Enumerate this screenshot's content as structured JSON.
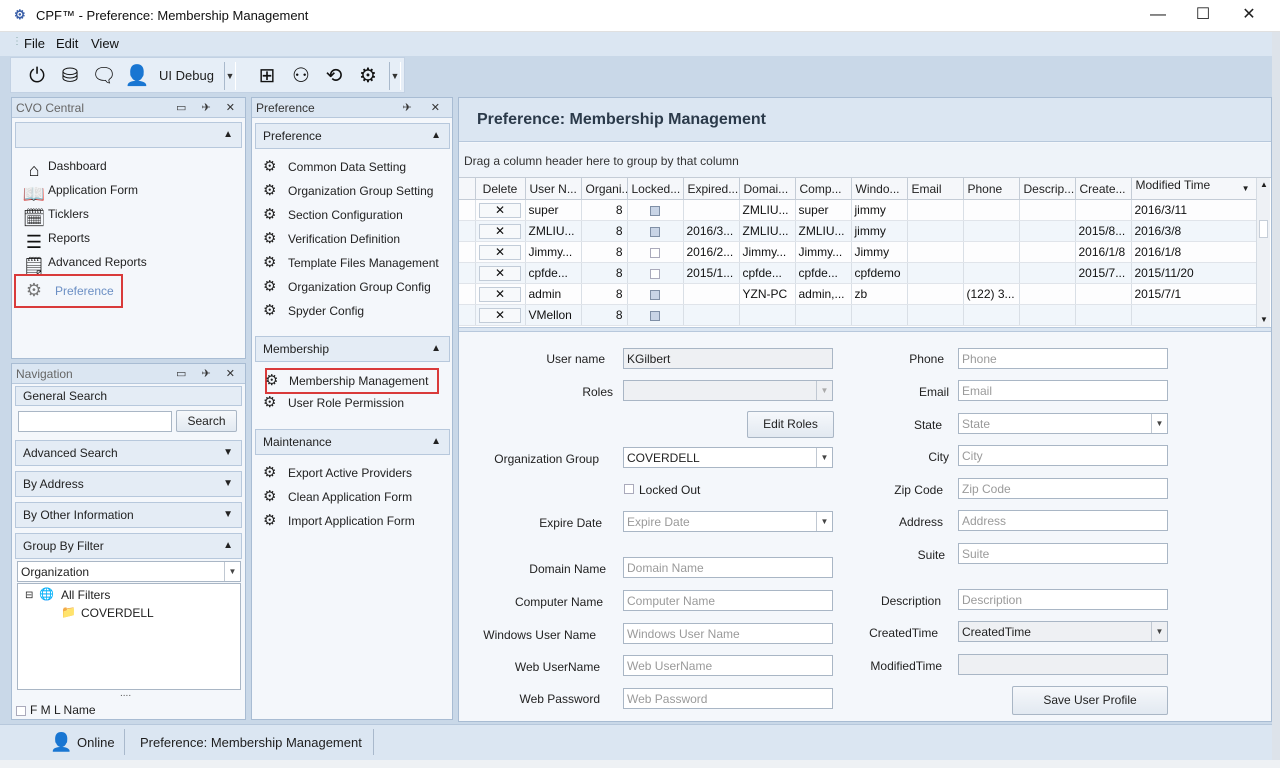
{
  "window": {
    "app_title": "CPF™  -  Preference: Membership Management",
    "minimize": "—",
    "maximize": "☐",
    "close": "✕"
  },
  "menu": [
    "File",
    "Edit",
    "View"
  ],
  "toolbar": {
    "ui_debug_label": "UI Debug"
  },
  "cvo_central": {
    "title": "CVO Central",
    "items": [
      {
        "label": "Dashboard",
        "icon": "home-icon"
      },
      {
        "label": "Application Form",
        "icon": "book-icon"
      },
      {
        "label": "Ticklers",
        "icon": "calendar-clock-icon"
      },
      {
        "label": "Reports",
        "icon": "lines-icon"
      },
      {
        "label": "Advanced Reports",
        "icon": "document-icon"
      },
      {
        "label": "Preference",
        "icon": "gears-icon"
      }
    ]
  },
  "navigation": {
    "title": "Navigation",
    "general_search": "General Search",
    "search_button": "Search",
    "advanced_search": "Advanced Search",
    "by_address": "By Address",
    "by_other": "By Other Information",
    "group_by_filter": "Group By Filter",
    "group_select": "Organization",
    "tree": {
      "root": "All Filters",
      "child": "COVERDELL"
    },
    "fml_name": "F M L Name",
    "grip": "...."
  },
  "preference_panel": {
    "title": "Preference",
    "sections": {
      "preference": {
        "title": "Preference",
        "items": [
          "Common Data Setting",
          "Organization Group Setting",
          "Section Configuration",
          "Verification Definition",
          "Template Files Management",
          "Organization Group Config",
          "Spyder Config"
        ]
      },
      "membership": {
        "title": "Membership",
        "items": [
          "Membership Management",
          "User Role Permission"
        ]
      },
      "maintenance": {
        "title": "Maintenance",
        "items": [
          "Export Active Providers",
          "Clean Application Form",
          "Import Application Form"
        ]
      }
    }
  },
  "main": {
    "title": "Preference: Membership Management",
    "group_hint": "Drag a column header here to group by that column",
    "columns": [
      "Delete",
      "User N...",
      "Organi...",
      "Locked...",
      "Expired...",
      "Domai...",
      "Comp...",
      "Windo...",
      "Email",
      "Phone",
      "Descrip...",
      "Create...",
      "Modified Time"
    ],
    "rows": [
      {
        "del": "✕",
        "user": "super",
        "org": "8",
        "locked": true,
        "expired": "",
        "domain": "ZMLIU...",
        "comp": "super",
        "win": "jimmy",
        "email": "",
        "phone": "",
        "desc": "",
        "created": "",
        "modified": "2016/3/11"
      },
      {
        "del": "✕",
        "user": "ZMLIU...",
        "org": "8",
        "locked": true,
        "expired": "2016/3...",
        "domain": "ZMLIU...",
        "comp": "ZMLIU...",
        "win": "jimmy",
        "email": "",
        "phone": "",
        "desc": "",
        "created": "2015/8...",
        "modified": "2016/3/8"
      },
      {
        "del": "✕",
        "user": "Jimmy...",
        "org": "8",
        "locked": false,
        "expired": "2016/2...",
        "domain": "Jimmy...",
        "comp": "Jimmy...",
        "win": "Jimmy",
        "email": "",
        "phone": "",
        "desc": "",
        "created": "2016/1/8",
        "modified": "2016/1/8"
      },
      {
        "del": "✕",
        "user": "cpfde...",
        "org": "8",
        "locked": false,
        "expired": "2015/1...",
        "domain": "cpfde...",
        "comp": "cpfde...",
        "win": "cpfdemo",
        "email": "",
        "phone": "",
        "desc": "",
        "created": "2015/7...",
        "modified": "2015/11/20"
      },
      {
        "del": "✕",
        "user": "admin",
        "org": "8",
        "locked": true,
        "expired": "",
        "domain": "YZN-PC",
        "comp": "admin,...",
        "win": "zb",
        "email": "",
        "phone": "(122) 3...",
        "desc": "",
        "created": "",
        "modified": "2015/7/1"
      },
      {
        "del": "✕",
        "user": "VMellon",
        "org": "8",
        "locked": true,
        "expired": "",
        "domain": "",
        "comp": "",
        "win": "",
        "email": "",
        "phone": "",
        "desc": "",
        "created": "",
        "modified": ""
      }
    ],
    "form": {
      "user_name_label": "User name",
      "user_name_value": "KGilbert",
      "roles_label": "Roles",
      "edit_roles": "Edit Roles",
      "org_group_label": "Organization Group",
      "org_group_value": "COVERDELL",
      "locked_out": "Locked Out",
      "expire_label": "Expire Date",
      "expire_ph": "Expire Date",
      "domain_label": "Domain Name",
      "domain_ph": "Domain Name",
      "computer_label": "Computer Name",
      "computer_ph": "Computer Name",
      "winuser_label": "Windows User Name",
      "winuser_ph": "Windows User Name",
      "webuser_label": "Web UserName",
      "webuser_ph": "Web UserName",
      "webpass_label": "Web Password",
      "webpass_ph": "Web Password",
      "phone_label": "Phone",
      "phone_ph": "Phone",
      "email_label": "Email",
      "email_ph": "Email",
      "state_label": "State",
      "state_ph": "State",
      "city_label": "City",
      "city_ph": "City",
      "zip_label": "Zip Code",
      "zip_ph": "Zip Code",
      "address_label": "Address",
      "address_ph": "Address",
      "suite_label": "Suite",
      "suite_ph": "Suite",
      "desc_label": "Description",
      "desc_ph": "Description",
      "created_label": "CreatedTime",
      "created_value": "CreatedTime",
      "modified_label": "ModifiedTime",
      "save": "Save User Profile"
    }
  },
  "status": {
    "online": "Online",
    "page": "Preference: Membership Management"
  }
}
